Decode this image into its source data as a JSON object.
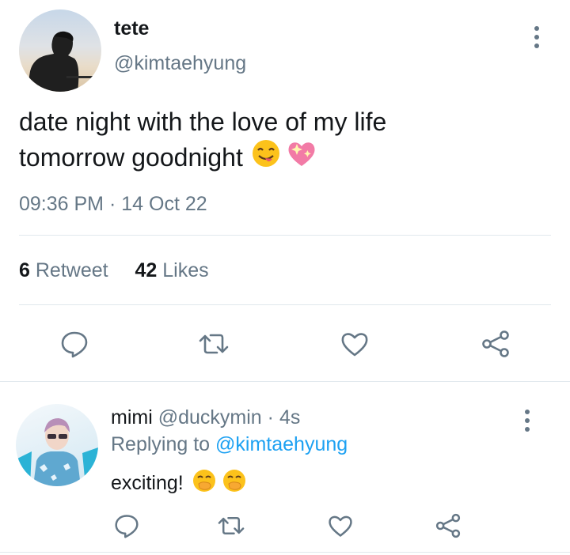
{
  "tweet": {
    "display_name": "tete",
    "handle": "@kimtaehyung",
    "text_line1": "date night with the love of my life",
    "text_line2": "tomorrow goodnight",
    "time": "09:36 PM",
    "separator": "·",
    "date": "14 Oct 22",
    "retweet_count": "6",
    "retweet_label": "Retweet",
    "likes_count": "42",
    "likes_label": "Likes"
  },
  "reply": {
    "display_name": "mimi",
    "handle": "@duckymin",
    "separator": "·",
    "age": "4s",
    "replying_label": "Replying to",
    "replying_handle": "@kimtaehyung",
    "text": "exciting!"
  },
  "icons": [
    "reply-icon",
    "retweet-icon",
    "like-icon",
    "share-icon",
    "more-icon"
  ],
  "colors": {
    "accent": "#1da1f2",
    "muted": "#657786",
    "text": "#14171a",
    "divider": "#e1e8ed"
  }
}
